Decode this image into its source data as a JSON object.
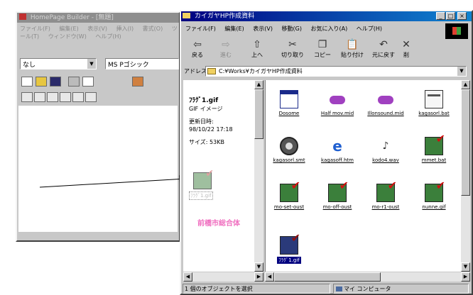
{
  "editor": {
    "title": "HomePage Builder - [無題]",
    "menu": [
      "ファイル(F)",
      "編集(E)",
      "表示(V)",
      "挿入(I)",
      "書式(O)",
      "ツール(T)",
      "ウィンドウ(W)",
      "ヘルプ(H)"
    ],
    "style_value": "なし",
    "font_value": "MS Pゴシック"
  },
  "explorer": {
    "title": "カイガヤHP作成資料",
    "menu": [
      "ファイル(F)",
      "編集(E)",
      "表示(V)",
      "移動(G)",
      "お気に入り(A)",
      "ヘルプ(H)"
    ],
    "toolbar": [
      "戻る",
      "進む",
      "上へ",
      "切り取り",
      "コピー",
      "貼り付け",
      "元に戻す",
      "削"
    ],
    "address_label": "アドレス",
    "address_value": "C:¥Works¥カイガヤHP作成資料",
    "preview": {
      "filename": "ﾌﾗｸﾞ1.gif",
      "filetype": "GIF イメージ",
      "modified_label": "更新日時:",
      "modified_value": "98/10/22 17:18",
      "size_label": "サイズ:",
      "size_value": "53KB",
      "thumb_caption": "ﾌﾗｸﾞ1.gif",
      "banner_text": "前橋市総合体"
    },
    "files": [
      {
        "name": "Dosome",
        "icon": "window-icon"
      },
      {
        "name": "Half mov.mid",
        "icon": "midi-icon"
      },
      {
        "name": "Illonsound.mid",
        "icon": "midi-icon"
      },
      {
        "name": "kagasorl.bat",
        "icon": "bat-icon"
      },
      {
        "name": "kagasorl.smt",
        "icon": "film-icon"
      },
      {
        "name": "kagasoff.htm",
        "icon": "ie-icon"
      },
      {
        "name": "kodo4.wav",
        "icon": "sound-icon"
      },
      {
        "name": "mmet.bat",
        "icon": "image-icon"
      },
      {
        "name": "mo-set-oust",
        "icon": "image-icon"
      },
      {
        "name": "mo-off-oust",
        "icon": "image-icon"
      },
      {
        "name": "mo-r1-oust",
        "icon": "image-icon"
      },
      {
        "name": "nunne.gif",
        "icon": "image-icon"
      },
      {
        "name": "ﾌﾗｸﾞ1.gif",
        "icon": "image-icon",
        "selected": true
      }
    ],
    "status_left": "1 個のオブジェクトを選択",
    "status_right": "マイ コンピュータ"
  }
}
